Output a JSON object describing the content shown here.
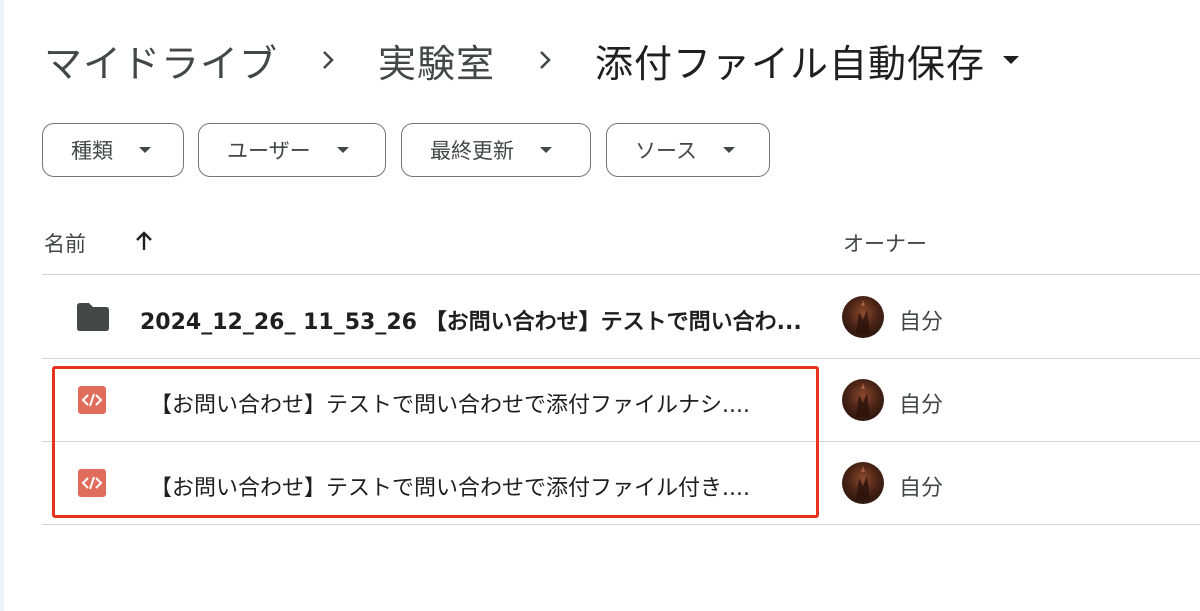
{
  "breadcrumb": {
    "items": [
      "マイドライブ",
      "実験室"
    ],
    "current": "添付ファイル自動保存"
  },
  "filters": [
    {
      "label": "種類"
    },
    {
      "label": "ユーザー"
    },
    {
      "label": "最終更新"
    },
    {
      "label": "ソース"
    }
  ],
  "header": {
    "name": "名前",
    "owner": "オーナー",
    "sort": "ascending"
  },
  "rows": [
    {
      "type": "folder",
      "name": "2024_12_26_ 11_53_26 【お問い合わせ】テストで問い合わ...",
      "owner": "自分"
    },
    {
      "type": "html-file",
      "name": "【お問い合わせ】テストで問い合わせで添付ファイルナシ....",
      "owner": "自分"
    },
    {
      "type": "html-file",
      "name": "【お問い合わせ】テストで問い合わせで添付ファイル付き....",
      "owner": "自分"
    }
  ],
  "colors": {
    "highlight": "#e8321e",
    "code_icon": "#e06c5b",
    "folder_icon": "#444746"
  }
}
